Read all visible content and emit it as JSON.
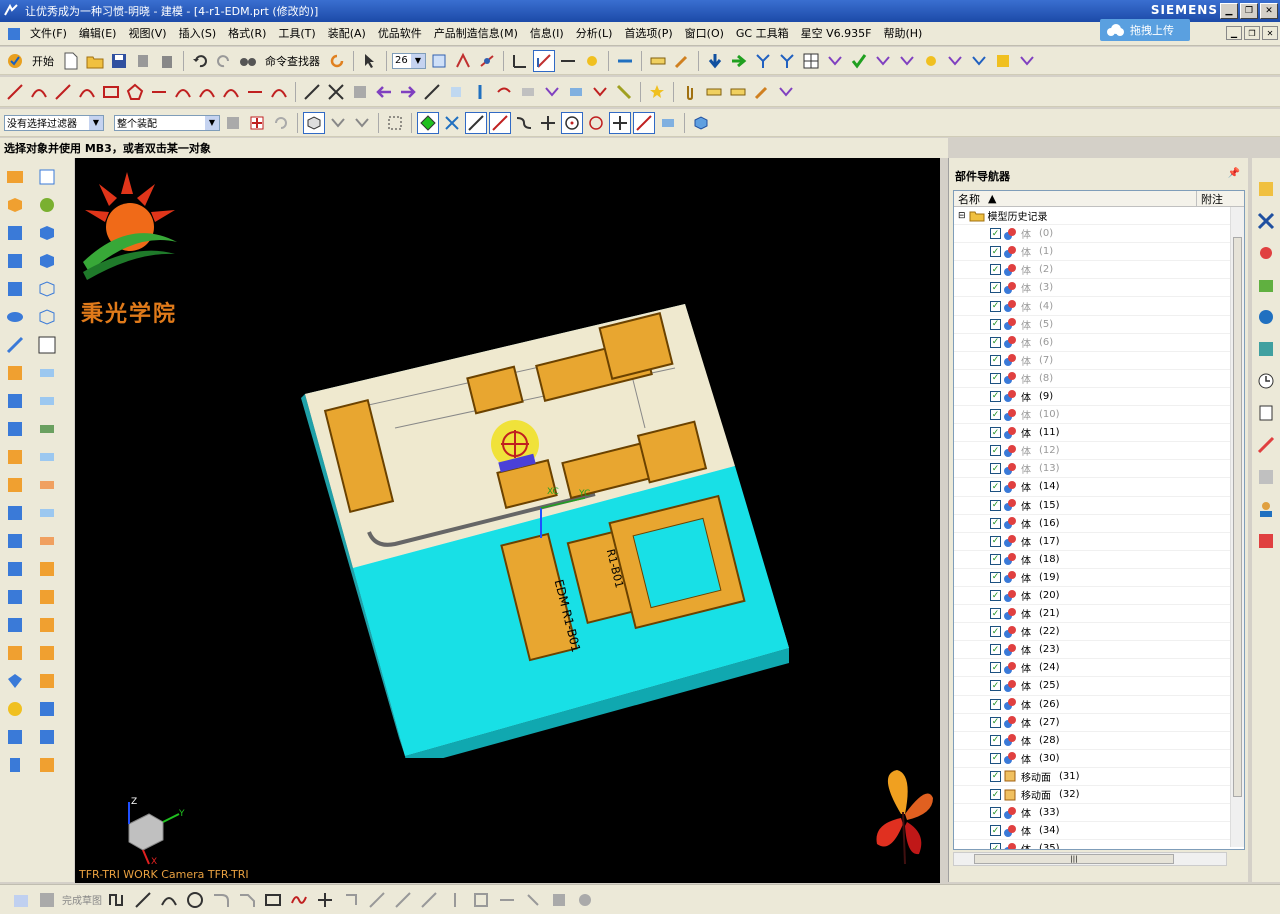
{
  "window": {
    "title": "让优秀成为一种习惯-明晓 - 建模 - [4-r1-EDM.prt  (修改的)]",
    "brand": "SIEMENS"
  },
  "menu": {
    "items": [
      "文件(F)",
      "编辑(E)",
      "视图(V)",
      "插入(S)",
      "格式(R)",
      "工具(T)",
      "装配(A)",
      "优品软件",
      "产品制造信息(M)",
      "信息(I)",
      "分析(L)",
      "首选项(P)",
      "窗口(O)",
      "GC 工具箱",
      "星空 V6.935F",
      "帮助(H)"
    ],
    "cloud_upload": "拖拽上传"
  },
  "toolbar1": {
    "start_label": "开始",
    "command_finder": "命令查找器",
    "count_value": "26"
  },
  "toolbar3": {
    "filter": "没有选择过滤器",
    "assembly": "整个装配"
  },
  "status": {
    "prompt": "选择对象并使用 MB3，或者双击某一对象"
  },
  "viewport": {
    "caption": "TFR-TRI WORK Camera TFR-TRI",
    "logo_text": "秉光学院",
    "label_xc": "XC",
    "label_yc": "YC",
    "engraving_a": "EDM R1-B01",
    "engraving_b": "R1-B01",
    "axis_y": "Y",
    "axis_z": "Z",
    "axis_x": "X"
  },
  "navigator": {
    "title": "部件导航器",
    "columns": {
      "name": "名称",
      "attachment": "附注"
    },
    "root": "模型历史记录",
    "rows": [
      {
        "label": "体",
        "idx": "(0)",
        "dim": true
      },
      {
        "label": "体",
        "idx": "(1)",
        "dim": true
      },
      {
        "label": "体",
        "idx": "(2)",
        "dim": true
      },
      {
        "label": "体",
        "idx": "(3)",
        "dim": true
      },
      {
        "label": "体",
        "idx": "(4)",
        "dim": true
      },
      {
        "label": "体",
        "idx": "(5)",
        "dim": true
      },
      {
        "label": "体",
        "idx": "(6)",
        "dim": true
      },
      {
        "label": "体",
        "idx": "(7)",
        "dim": true
      },
      {
        "label": "体",
        "idx": "(8)",
        "dim": true
      },
      {
        "label": "体",
        "idx": "(9)",
        "dim": false
      },
      {
        "label": "体",
        "idx": "(10)",
        "dim": true
      },
      {
        "label": "体",
        "idx": "(11)",
        "dim": false
      },
      {
        "label": "体",
        "idx": "(12)",
        "dim": true
      },
      {
        "label": "体",
        "idx": "(13)",
        "dim": true
      },
      {
        "label": "体",
        "idx": "(14)",
        "dim": false
      },
      {
        "label": "体",
        "idx": "(15)",
        "dim": false
      },
      {
        "label": "体",
        "idx": "(16)",
        "dim": false
      },
      {
        "label": "体",
        "idx": "(17)",
        "dim": false
      },
      {
        "label": "体",
        "idx": "(18)",
        "dim": false
      },
      {
        "label": "体",
        "idx": "(19)",
        "dim": false
      },
      {
        "label": "体",
        "idx": "(20)",
        "dim": false
      },
      {
        "label": "体",
        "idx": "(21)",
        "dim": false
      },
      {
        "label": "体",
        "idx": "(22)",
        "dim": false
      },
      {
        "label": "体",
        "idx": "(23)",
        "dim": false
      },
      {
        "label": "体",
        "idx": "(24)",
        "dim": false
      },
      {
        "label": "体",
        "idx": "(25)",
        "dim": false
      },
      {
        "label": "体",
        "idx": "(26)",
        "dim": false
      },
      {
        "label": "体",
        "idx": "(27)",
        "dim": false
      },
      {
        "label": "体",
        "idx": "(28)",
        "dim": false
      },
      {
        "label": "体",
        "idx": "(30)",
        "dim": false
      },
      {
        "label": "移动面",
        "idx": "(31)",
        "dim": false,
        "face": true
      },
      {
        "label": "移动面",
        "idx": "(32)",
        "dim": false,
        "face": true
      },
      {
        "label": "体",
        "idx": "(33)",
        "dim": false
      },
      {
        "label": "体",
        "idx": "(34)",
        "dim": false
      },
      {
        "label": "体",
        "idx": "(35)",
        "dim": false
      }
    ]
  },
  "bottombar": {
    "finish_sketch": "完成草图"
  },
  "colors": {
    "titlebar": "#1c4aa8",
    "viewport_bg": "#000000",
    "plate_top": "#efe9cf",
    "cavity": "#18e0e6",
    "electrode": "#e8a630",
    "accent": "#316ac5"
  }
}
